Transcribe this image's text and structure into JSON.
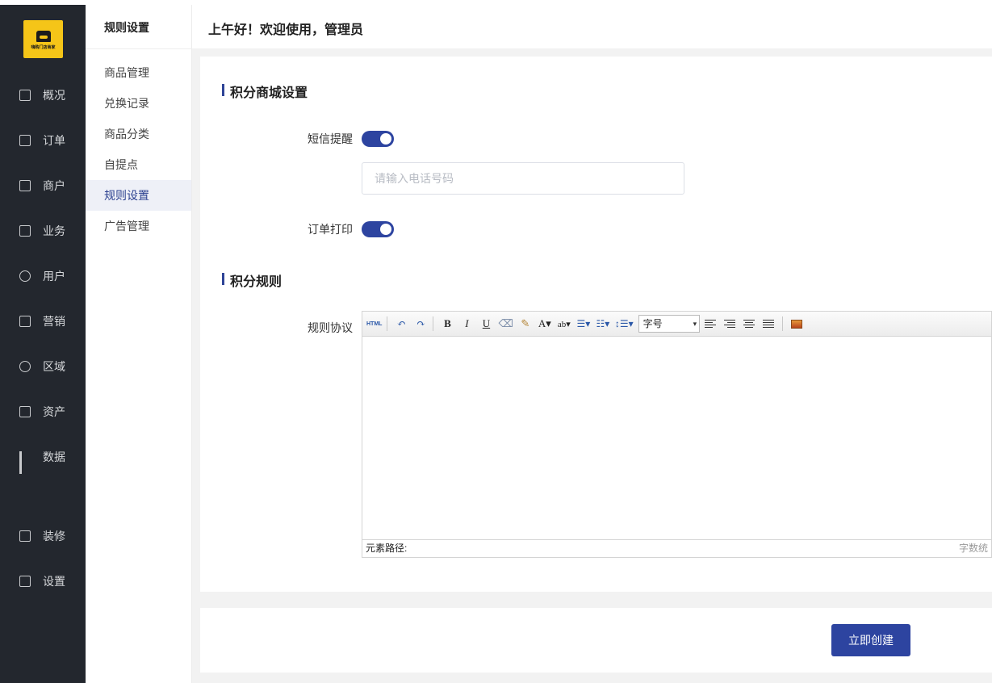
{
  "logo": {
    "text": "嗨购门店商家"
  },
  "sidebar": {
    "items": [
      {
        "label": "概况",
        "icon": "dashboard-icon"
      },
      {
        "label": "订单",
        "icon": "order-icon"
      },
      {
        "label": "商户",
        "icon": "merchant-icon"
      },
      {
        "label": "业务",
        "icon": "business-icon"
      },
      {
        "label": "用户",
        "icon": "user-icon"
      },
      {
        "label": "营销",
        "icon": "marketing-icon"
      },
      {
        "label": "区域",
        "icon": "region-icon"
      },
      {
        "label": "资产",
        "icon": "asset-icon"
      },
      {
        "label": "数据",
        "icon": "data-icon"
      },
      {
        "label": "装修",
        "icon": "decoration-icon"
      },
      {
        "label": "设置",
        "icon": "settings-icon"
      }
    ]
  },
  "subnav": {
    "title": "规则设置",
    "items": [
      {
        "label": "商品管理"
      },
      {
        "label": "兑换记录"
      },
      {
        "label": "商品分类"
      },
      {
        "label": "自提点"
      },
      {
        "label": "规则设置",
        "active": true
      },
      {
        "label": "广告管理"
      }
    ]
  },
  "header": {
    "greeting": "上午好！欢迎使用，管理员"
  },
  "form": {
    "section1_title": "积分商城设置",
    "sms_label": "短信提醒",
    "sms_enabled": true,
    "phone_placeholder": "请输入电话号码",
    "print_label": "订单打印",
    "print_enabled": true,
    "section2_title": "积分规则",
    "rules_label": "规则协议"
  },
  "editor": {
    "html_label": "HTML",
    "font_size_label": "字号",
    "path_label": "元素路径:",
    "count_label": "字数统"
  },
  "footer": {
    "create_label": "立即创建"
  },
  "colors": {
    "sidebar_bg": "#23272e",
    "accent": "#2d44a0",
    "logo_bg": "#f5c518"
  }
}
